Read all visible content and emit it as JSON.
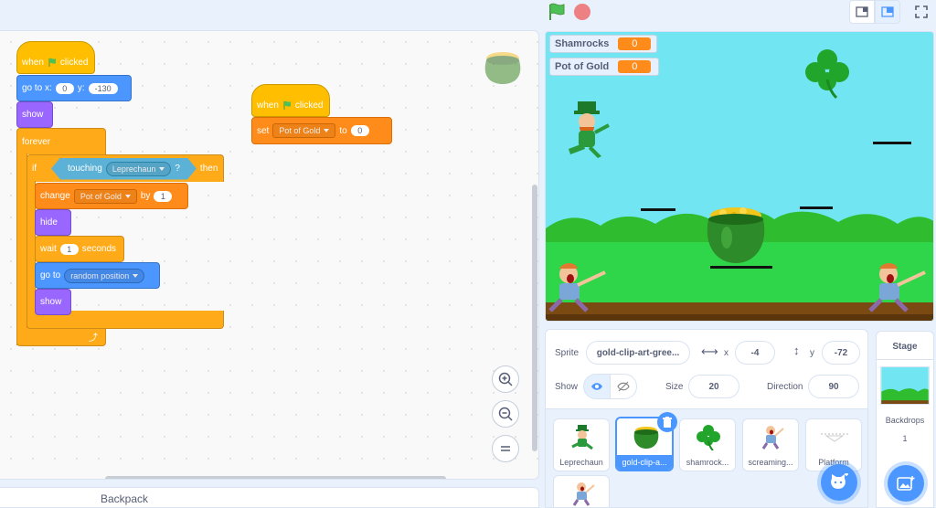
{
  "header": {
    "green_flag": "green-flag-icon",
    "stop": "stop-icon"
  },
  "code": {
    "script1": {
      "hat_when": "when",
      "hat_clicked": "clicked",
      "goto_label": "go to x:",
      "goto_x": "0",
      "goto_y_label": "y:",
      "goto_y": "-130",
      "show1": "show",
      "forever": "forever",
      "if_label": "if",
      "touching_label": "touching",
      "touching_target": "Leprechaun",
      "touching_q": "?",
      "then_label": "then",
      "change_label": "change",
      "change_var": "Pot of Gold",
      "change_by": "by",
      "change_value": "1",
      "hide": "hide",
      "wait_label": "wait",
      "wait_value": "1",
      "wait_unit": "seconds",
      "goto2_label": "go to",
      "goto2_target": "random position",
      "show2": "show"
    },
    "script2": {
      "hat_when": "when",
      "hat_clicked": "clicked",
      "set_label": "set",
      "set_var": "Pot of Gold",
      "set_to": "to",
      "set_value": "0"
    }
  },
  "backpack": {
    "label": "Backpack"
  },
  "stage": {
    "monitors": [
      {
        "name": "Shamrocks",
        "value": "0"
      },
      {
        "name": "Pot of Gold",
        "value": "0"
      }
    ]
  },
  "sprite_info": {
    "sprite_label": "Sprite",
    "sprite_name": "gold-clip-art-gree...",
    "x_label": "x",
    "x_value": "-4",
    "y_label": "y",
    "y_value": "-72",
    "show_label": "Show",
    "size_label": "Size",
    "size_value": "20",
    "direction_label": "Direction",
    "direction_value": "90"
  },
  "sprites": [
    {
      "name": "Leprechaun"
    },
    {
      "name": "gold-clip-a..."
    },
    {
      "name": "shamrock..."
    },
    {
      "name": "screaming..."
    },
    {
      "name": "Platform"
    }
  ],
  "stage_pane": {
    "title": "Stage",
    "backdrops_label": "Backdrops",
    "backdrops_count": "1"
  },
  "colors": {
    "events": "#ffbf00",
    "motion": "#4c97ff",
    "looks": "#9966ff",
    "control": "#ffab19",
    "variables": "#ff8c1a",
    "sensing": "#5cb1d6",
    "accent": "#4c97ff"
  }
}
